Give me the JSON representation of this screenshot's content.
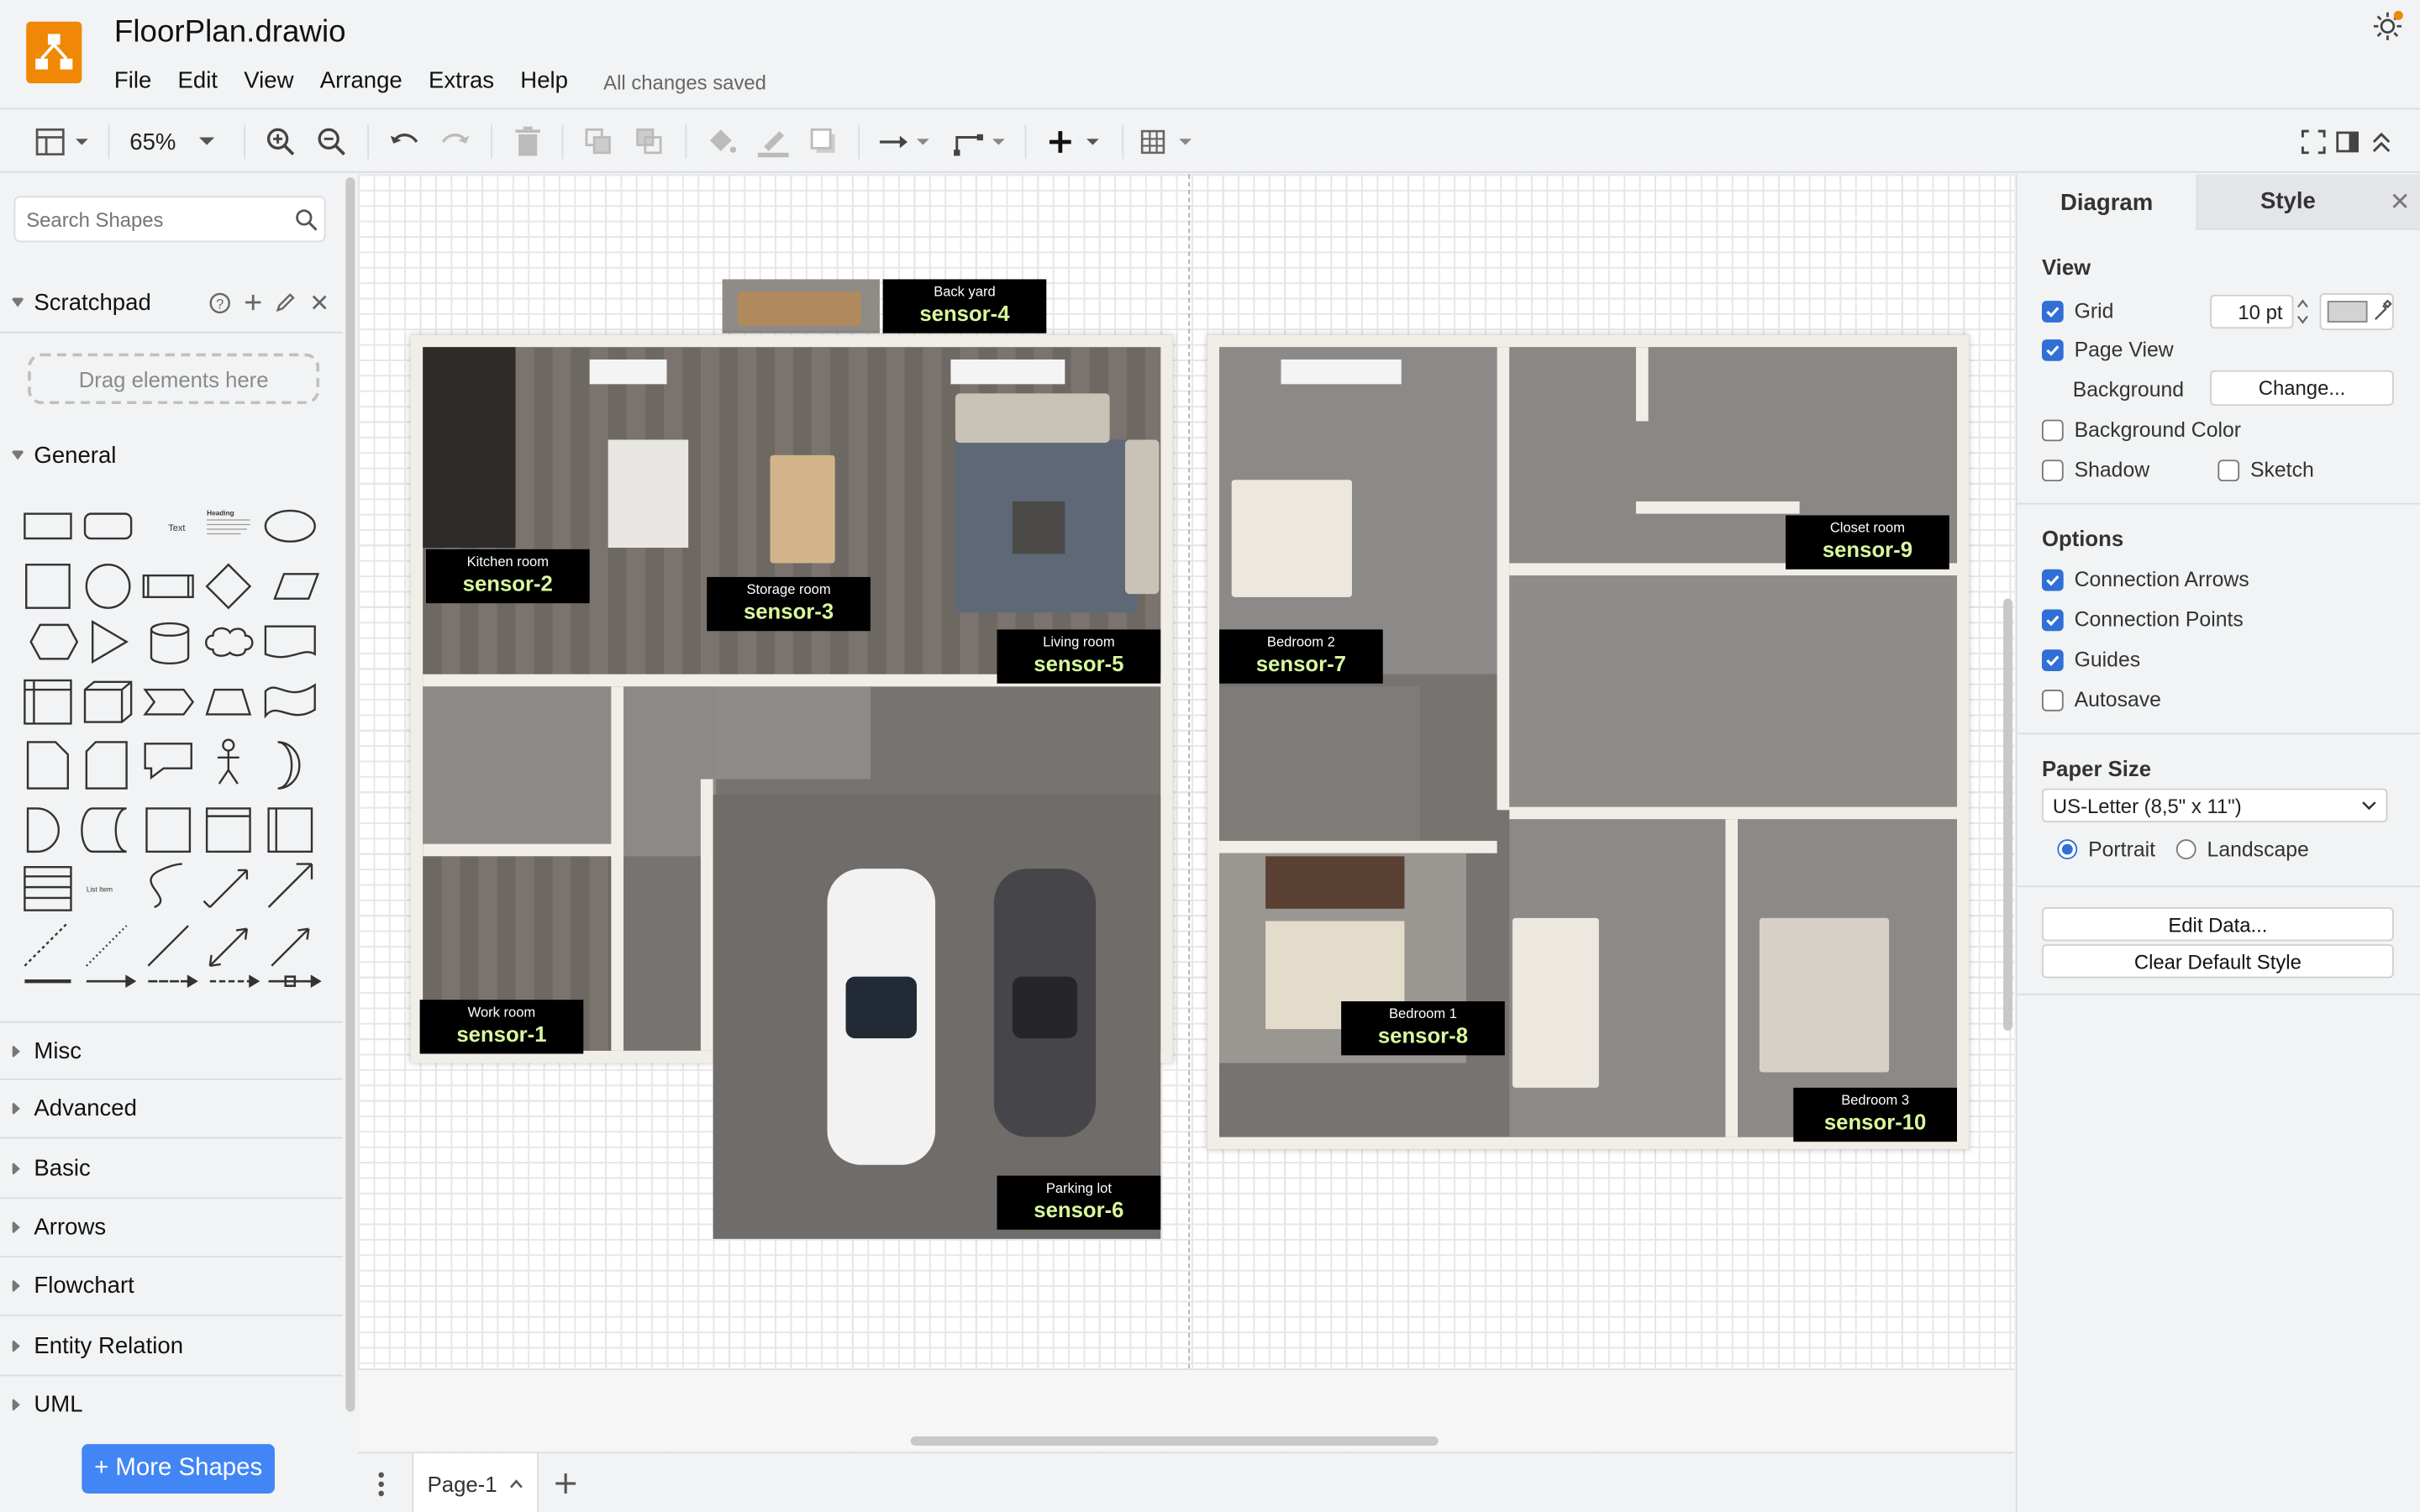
{
  "app": {
    "title": "FloorPlan.drawio",
    "save_status": "All changes saved",
    "accent_color": "#f08705"
  },
  "menu": [
    "File",
    "Edit",
    "View",
    "Arrange",
    "Extras",
    "Help"
  ],
  "toolbar": {
    "zoom": "65%"
  },
  "sidebar": {
    "search_placeholder": "Search Shapes",
    "scratchpad": {
      "title": "Scratchpad",
      "drop_hint": "Drag elements here"
    },
    "general": {
      "title": "General",
      "text_shape": "Text",
      "heading_shape": "Heading",
      "list_shape": "List Item"
    },
    "libraries": [
      "Misc",
      "Advanced",
      "Basic",
      "Arrows",
      "Flowchart",
      "Entity Relation",
      "UML"
    ],
    "more_shapes": "+ More Shapes"
  },
  "canvas": {
    "sensors": [
      {
        "room": "Back yard",
        "sensor": "sensor-4"
      },
      {
        "room": "Kitchen room",
        "sensor": "sensor-2"
      },
      {
        "room": "Storage room",
        "sensor": "sensor-3"
      },
      {
        "room": "Living room",
        "sensor": "sensor-5"
      },
      {
        "room": "Work room",
        "sensor": "sensor-1"
      },
      {
        "room": "Parking lot",
        "sensor": "sensor-6"
      },
      {
        "room": "Closet room",
        "sensor": "sensor-9"
      },
      {
        "room": "Bedroom 2",
        "sensor": "sensor-7"
      },
      {
        "room": "Bedroom 1",
        "sensor": "sensor-8"
      },
      {
        "room": "Bedroom 3",
        "sensor": "sensor-10"
      }
    ]
  },
  "pages": {
    "current": "Page-1"
  },
  "format_panel": {
    "tabs": {
      "diagram": "Diagram",
      "style": "Style"
    },
    "view": {
      "title": "View",
      "grid": "Grid",
      "grid_size": "10 pt",
      "page_view": "Page View",
      "background": "Background",
      "change": "Change...",
      "background_color": "Background Color",
      "shadow": "Shadow",
      "sketch": "Sketch"
    },
    "options": {
      "title": "Options",
      "connection_arrows": "Connection Arrows",
      "connection_points": "Connection Points",
      "guides": "Guides",
      "autosave": "Autosave"
    },
    "paper": {
      "title": "Paper Size",
      "selected": "US-Letter (8,5\" x 11\")",
      "portrait": "Portrait",
      "landscape": "Landscape"
    },
    "edit_data": "Edit Data...",
    "clear_default_style": "Clear Default Style"
  }
}
